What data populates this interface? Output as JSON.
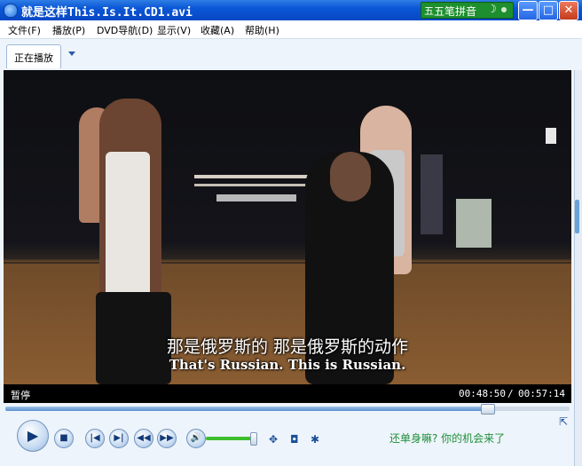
{
  "window": {
    "title": "就是这样This.Is.It.CD1.avi",
    "icon": "wmp-logo-icon"
  },
  "ime_bar": {
    "label": "五笔拼音",
    "logo": "五",
    "mode_icon": "☽",
    "accent_color": "#1e8f2e"
  },
  "window_buttons": {
    "minimize": "—",
    "maximize": "□",
    "close": "✕"
  },
  "menu": [
    "文件(F)",
    "播放(P)",
    "DVD导航(D)",
    "显示(V)",
    "收藏(A)",
    "帮助(H)"
  ],
  "tabs": {
    "now_playing": "正在播放"
  },
  "video": {
    "subtitle_cn": "那是俄罗斯的 那是俄罗斯的动作",
    "subtitle_en": "That's Russian. This is Russian."
  },
  "status": {
    "state": "暂停",
    "current_time": "00:48:50",
    "separator": "/",
    "total_time": "00:57:14"
  },
  "seek": {
    "progress_fraction": 0.853
  },
  "volume": {
    "level_fraction": 0.95,
    "color": "#3cbf2d"
  },
  "controls": {
    "play": "▶",
    "stop": "■",
    "previous": "|◀",
    "next": "▶|",
    "rewind": "◀◀",
    "fast_forward": "▶▶",
    "mute": "🔊",
    "fullscreen": "✥",
    "snapshot": "◘",
    "settings": "✱",
    "mini_mode": "⇱"
  },
  "promo_link": "还单身嘛? 你的机会来了"
}
